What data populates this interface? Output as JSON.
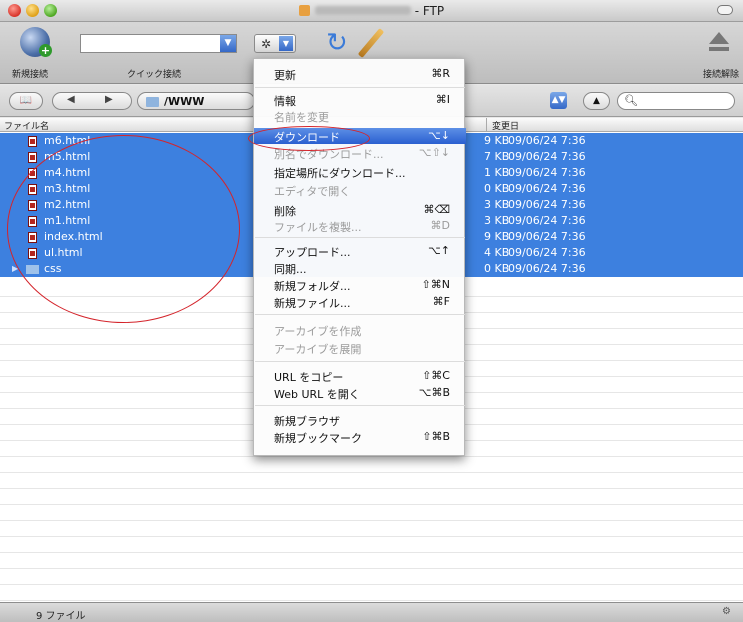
{
  "window": {
    "title_suffix": "- FTP"
  },
  "toolbar": {
    "new_connection_label": "新規接続",
    "quick_connect_label": "クイック接続",
    "quick_connect_value": "",
    "disconnect_label": "接続解除"
  },
  "pathbar": {
    "path": "/WWW",
    "search_value": ""
  },
  "columns": {
    "name": "ファイル名",
    "modified": "変更日"
  },
  "files": [
    {
      "name": "m6.html",
      "size": "9 KB",
      "date": "09/06/24 7:36",
      "type": "file"
    },
    {
      "name": "m5.html",
      "size": "7 KB",
      "date": "09/06/24 7:36",
      "type": "file"
    },
    {
      "name": "m4.html",
      "size": "1 KB",
      "date": "09/06/24 7:36",
      "type": "file"
    },
    {
      "name": "m3.html",
      "size": "0 KB",
      "date": "09/06/24 7:36",
      "type": "file"
    },
    {
      "name": "m2.html",
      "size": "3 KB",
      "date": "09/06/24 7:36",
      "type": "file"
    },
    {
      "name": "m1.html",
      "size": "3 KB",
      "date": "09/06/24 7:36",
      "type": "file"
    },
    {
      "name": "index.html",
      "size": "9 KB",
      "date": "09/06/24 7:36",
      "type": "file"
    },
    {
      "name": "ul.html",
      "size": "4 KB",
      "date": "09/06/24 7:36",
      "type": "file"
    },
    {
      "name": "css",
      "size": "0 KB",
      "date": "09/06/24 7:36",
      "type": "folder"
    }
  ],
  "menu": {
    "items": [
      {
        "label": "更新",
        "shortcut": "⌘R",
        "state": "enabled"
      },
      {
        "label": "情報",
        "shortcut": "⌘I",
        "state": "enabled"
      },
      {
        "label": "名前を変更",
        "shortcut": "",
        "state": "disabled"
      },
      {
        "label": "ダウンロード",
        "shortcut": "⌥↓",
        "state": "highlighted"
      },
      {
        "label": "別名でダウンロード...",
        "shortcut": "⌥⇧↓",
        "state": "disabled"
      },
      {
        "label": "指定場所にダウンロード...",
        "shortcut": "",
        "state": "enabled"
      },
      {
        "label": "エディタで開く",
        "shortcut": "",
        "state": "disabled"
      },
      {
        "label": "削除",
        "shortcut": "⌘⌫",
        "state": "enabled"
      },
      {
        "label": "ファイルを複製...",
        "shortcut": "⌘D",
        "state": "disabled"
      },
      {
        "label": "アップロード...",
        "shortcut": "⌥↑",
        "state": "enabled"
      },
      {
        "label": "同期...",
        "shortcut": "",
        "state": "enabled"
      },
      {
        "label": "新規フォルダ...",
        "shortcut": "⇧⌘N",
        "state": "enabled"
      },
      {
        "label": "新規ファイル...",
        "shortcut": "⌘F",
        "state": "enabled"
      },
      {
        "label": "アーカイブを作成",
        "shortcut": "",
        "state": "disabled"
      },
      {
        "label": "アーカイブを展開",
        "shortcut": "",
        "state": "disabled"
      },
      {
        "label": "URL をコピー",
        "shortcut": "⇧⌘C",
        "state": "enabled"
      },
      {
        "label": "Web URL を開く",
        "shortcut": "⌥⌘B",
        "state": "enabled"
      },
      {
        "label": "新規ブラウザ",
        "shortcut": "",
        "state": "enabled"
      },
      {
        "label": "新規ブックマーク",
        "shortcut": "⇧⌘B",
        "state": "enabled"
      }
    ]
  },
  "status": {
    "text": "9 ファイル"
  }
}
